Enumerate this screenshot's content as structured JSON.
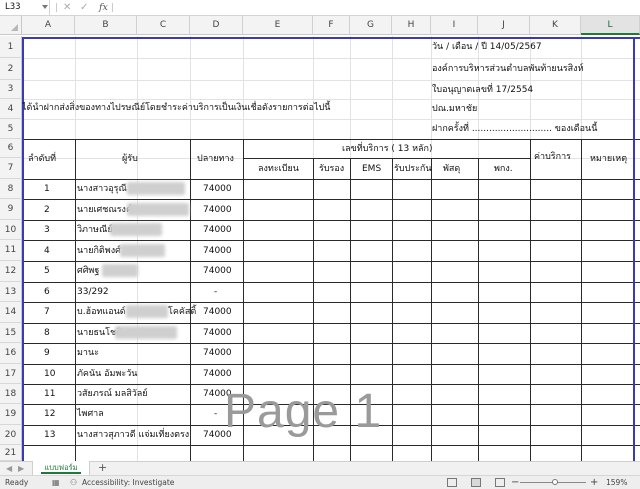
{
  "name_box": "L33",
  "formula_bar": {
    "fx_label": "fx",
    "cancel_glyph": "✕",
    "enter_glyph": "✓",
    "content": ""
  },
  "columns": [
    "A",
    "B",
    "C",
    "D",
    "E",
    "F",
    "G",
    "H",
    "I",
    "J",
    "K",
    "L"
  ],
  "rows": [
    "1",
    "2",
    "3",
    "4",
    "5",
    "6",
    "7",
    "8",
    "9",
    "10",
    "11",
    "12",
    "13",
    "14",
    "15",
    "16",
    "17",
    "18",
    "19",
    "20",
    "21"
  ],
  "sheet": {
    "date_line": "วัน / เดือน / ปี   14/05/2567",
    "org_name": "องค์การบริหารส่วนตำบลพันท้ายนรสิงห์",
    "license_no": "ใบอนุญาตเลขที่ 17/2554",
    "post_office": "ปณ.มหาชัย",
    "deposit_line": "ฝากครั้งที่ ............................ ของเดือนนี้",
    "intro": "ได้นำฝากส่งสิ่งของทางไปรษณีย์โดยชำระค่าบริการเป็นเงินเชื่อดังรายการต่อไปนี้",
    "headers": {
      "seq": "ลำดับที่",
      "recipient": "ผู้รับ",
      "destination": "ปลายทาง",
      "service_no": "เลขที่บริการ ( 13 หลัก)",
      "registered": "ลงทะเบียน",
      "certified": "รับรอง",
      "ems": "EMS",
      "insured": "รับประกัน",
      "parcel": "พัสดุ",
      "post_package": "พกง.",
      "fee": "ค่าบริการ",
      "remark": "หมายเหตุ"
    },
    "records": [
      {
        "seq": "1",
        "name": "นางสาวอุรุณี",
        "dest": "74000",
        "row": "8"
      },
      {
        "seq": "2",
        "name": "นายเศชณรงค์",
        "dest": "74000",
        "row": "9"
      },
      {
        "seq": "3",
        "name": "วิภาษณีย์",
        "dest": "74000",
        "row": "10"
      },
      {
        "seq": "4",
        "name": "นายกิติพงศ์",
        "dest": "74000",
        "row": "11"
      },
      {
        "seq": "5",
        "name": "ศศิพฐ",
        "dest": "74000",
        "row": "12"
      },
      {
        "seq": "6",
        "name": "33/292",
        "dest": "-",
        "row": "13"
      },
      {
        "seq": "7",
        "name": "บ.ฮ้อทแอนด์",
        "dest": "74000",
        "row": "14",
        "suffix": "โคคัสติ้"
      },
      {
        "seq": "8",
        "name": "นายธนโชติ",
        "dest": "74000",
        "row": "15"
      },
      {
        "seq": "9",
        "name": "มานะ",
        "dest": "74000",
        "row": "16"
      },
      {
        "seq": "10",
        "name": "ภัคนัน อัมพะวัน",
        "dest": "74000",
        "row": "17"
      },
      {
        "seq": "11",
        "name": "วสัยภรณ์ มลสิวัลย์",
        "dest": "74000",
        "row": "18"
      },
      {
        "seq": "12",
        "name": "ไพศาล",
        "dest": "-",
        "row": "19"
      },
      {
        "seq": "13",
        "name": "นางสาวสุภาวดี แจ่มเที่ยงตรง",
        "dest": "74000",
        "row": "20"
      }
    ]
  },
  "watermark": "Page 1",
  "tabs": {
    "active": "แบบฟอร์ม",
    "add": "+",
    "prev": "◀",
    "next": "▶"
  },
  "status": {
    "ready": "Ready",
    "accessibility": "Accessibility: Investigate",
    "zoom": "159%",
    "zoom_out": "−",
    "zoom_in": "+"
  }
}
